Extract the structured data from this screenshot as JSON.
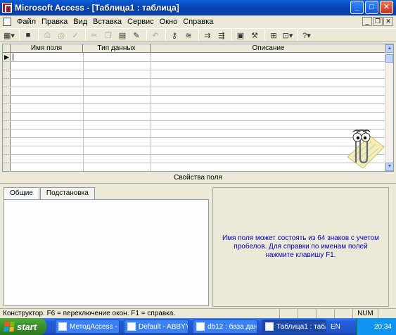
{
  "window": {
    "title": "Microsoft Access - [Таблица1 : таблица]"
  },
  "menu": [
    "Файл",
    "Правка",
    "Вид",
    "Вставка",
    "Сервис",
    "Окно",
    "Справка"
  ],
  "toolbar": [
    "table-view-icon",
    "save-icon",
    "print-icon",
    "preview-icon",
    "spell-icon",
    "cut-icon",
    "copy-icon",
    "paste-icon",
    "format-painter-icon",
    "undo-icon",
    "primary-key-icon",
    "indexes-icon",
    "insert-rows-icon",
    "delete-rows-icon",
    "properties-icon",
    "build-icon",
    "database-window-icon",
    "new-object-icon",
    "help-icon"
  ],
  "grid": {
    "columns": [
      "Имя поля",
      "Тип данных",
      "Описание"
    ]
  },
  "properties": {
    "label": "Свойства поля",
    "tabs": [
      "Общие",
      "Подстановка"
    ],
    "help_text": "Имя поля может состоять из 64 знаков с учетом пробелов.  Для справки по именам полей нажмите клавишу F1."
  },
  "status": {
    "text": "Конструктор.  F6 = переключение окон.  F1 = справка.",
    "num": "NUM"
  },
  "taskbar": {
    "start": "start",
    "tasks": [
      "МетодAccess - ...",
      "Default - ABBYY ...",
      "db12 : база дан...",
      "Таблица1 : табл..."
    ],
    "lang": "EN",
    "clock": "20:34"
  },
  "colors": {
    "title": "#0a5fd8",
    "help_text": "#0000c0",
    "taskbar": "#245edb",
    "start": "#3c8f2e"
  }
}
